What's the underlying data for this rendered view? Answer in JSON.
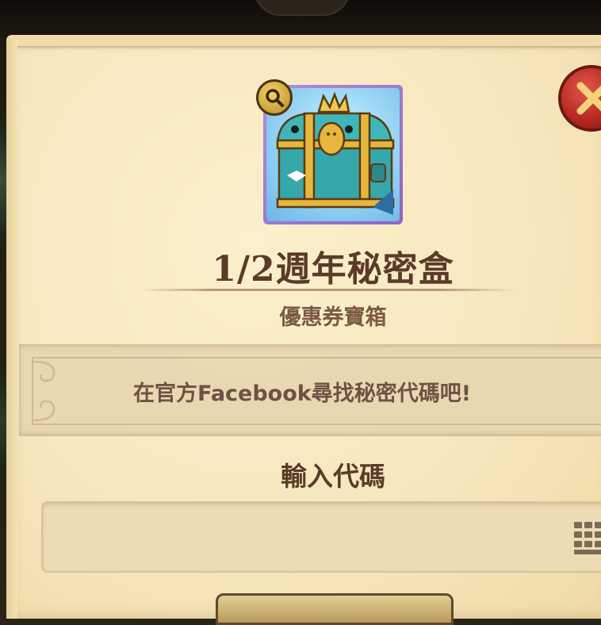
{
  "item": {
    "title": "1/2週年秘密盒",
    "type_label": "優惠券寶箱",
    "icon": "treasure-chest-icon",
    "frame_color": "#9b74cc"
  },
  "banner": {
    "text": "在官方Facebook尋找秘密代碼吧!"
  },
  "code_entry": {
    "label": "輸入代碼",
    "value": "",
    "keypad_icon": "keypad-icon"
  },
  "controls": {
    "close_icon": "close-icon",
    "inspect_icon": "magnifier-icon"
  },
  "colors": {
    "title": "#5a3b28",
    "parchment": "#f6e7bd",
    "close_button": "#c0352b"
  }
}
